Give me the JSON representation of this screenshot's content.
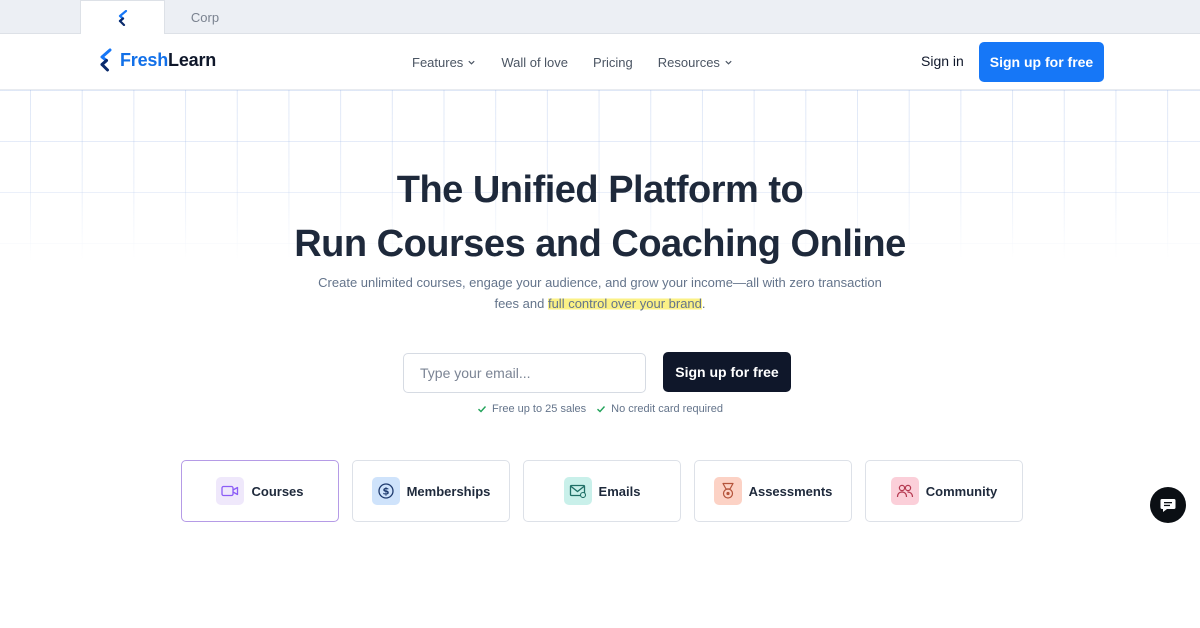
{
  "tabs": {
    "corp_label": "Corp"
  },
  "header": {
    "logo_part1": "Fresh",
    "logo_part2": "Learn",
    "nav": [
      {
        "label": "Features",
        "has_dropdown": true
      },
      {
        "label": "Wall of love",
        "has_dropdown": false
      },
      {
        "label": "Pricing",
        "has_dropdown": false
      },
      {
        "label": "Resources",
        "has_dropdown": true
      }
    ],
    "sign_in": "Sign in",
    "sign_up": "Sign up for free"
  },
  "hero": {
    "title_line1": "The Unified Platform to",
    "title_line2": "Run Courses and Coaching Online",
    "subtitle_line1": "Create unlimited courses, engage your audience, and grow your income—all with zero transaction",
    "subtitle_line2_pre": "fees and ",
    "subtitle_highlight": "full control over your brand",
    "subtitle_line2_post": ".",
    "email_placeholder": "Type your email...",
    "cta": "Sign up for free",
    "perks": [
      "Free up to 25 sales",
      "No credit card required"
    ]
  },
  "features": [
    {
      "label": "Courses",
      "icon": "video-camera-icon",
      "selected": true
    },
    {
      "label": "Memberships",
      "icon": "dollar-coin-icon",
      "selected": false
    },
    {
      "label": "Emails",
      "icon": "email-icon",
      "selected": false
    },
    {
      "label": "Assessments",
      "icon": "award-medal-icon",
      "selected": false
    },
    {
      "label": "Community",
      "icon": "people-icon",
      "selected": false
    }
  ],
  "colors": {
    "brand_blue": "#1677f7",
    "dark_button": "#0f172a",
    "highlight_yellow": "#fbf186",
    "selected_card_border": "#b59be6"
  }
}
